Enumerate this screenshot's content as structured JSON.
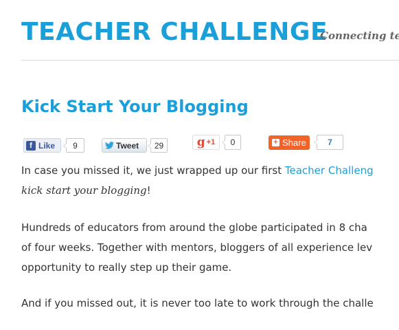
{
  "header": {
    "site_title": "TEACHER CHALLENGE",
    "tagline": "Connecting tea"
  },
  "post": {
    "title": "Kick Start Your Blogging"
  },
  "share_bar": {
    "facebook": {
      "label": "Like",
      "icon": "f",
      "count": "9"
    },
    "twitter": {
      "label": "Tweet",
      "count": "29"
    },
    "google_plus": {
      "icon": "g",
      "label": "+1",
      "count": "0"
    },
    "share": {
      "label": "Share",
      "count": "7"
    }
  },
  "content": {
    "p1_line1_prefix": "In case you missed it, we just wrapped up our first ",
    "p1_link": "Teacher Challeng",
    "p1_line2_emph": "kick start your blogging",
    "p1_line2_suffix": "!",
    "p2_line1": "Hundreds of educators from around the globe participated in 8 cha",
    "p2_line2": "of four weeks. Together with mentors, bloggers of all experience lev",
    "p2_line3": "opportunity to really step up their game.",
    "p3_line1": "And if you missed out, it is never too late to work through the challe"
  },
  "colors": {
    "accent": "#1a9fd9",
    "text": "#333333",
    "share_orange": "#f2632a",
    "facebook_blue": "#3b5998"
  }
}
